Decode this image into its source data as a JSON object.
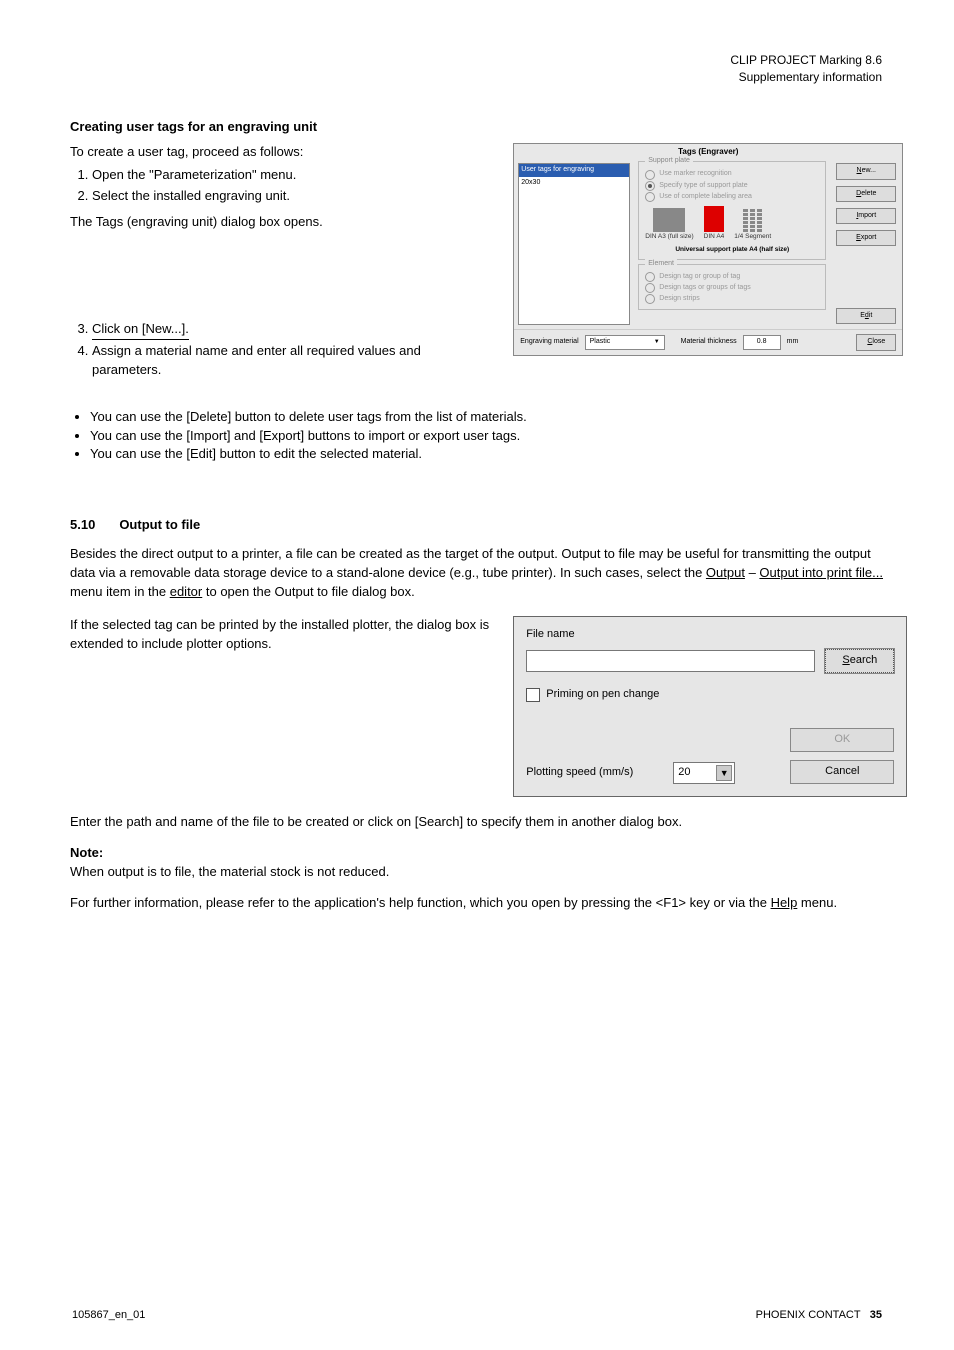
{
  "header": {
    "product": "CLIP PROJECT Marking 8.6",
    "subtitle": "Supplementary information"
  },
  "tagsSection": {
    "title": "Creating user tags for an engraving unit",
    "intro": "To create a user tag, proceed as follows:",
    "steps": [
      "Open the \"Parameterization\" menu.",
      "Select the installed engraving unit."
    ],
    "after": "The Tags (engraving unit) dialog box opens.",
    "followup": [
      "Click on [New...].",
      "Assign a material name and enter all required values and parameters."
    ],
    "bullets": [
      "You can use the [Delete] button to delete user tags from the list of materials.",
      "You can use the [Import] and [Export] buttons to import or export user tags.",
      "You can use the [Edit] button to edit the selected material."
    ]
  },
  "tagsDialog": {
    "title": "Tags (Engraver)",
    "list": {
      "header": "User tags for engraving",
      "item": "20x30"
    },
    "groupSupport": {
      "legend": "Support plate",
      "opt1": "Use marker recognition",
      "opt2": "Specify type of support plate",
      "opt3": "Use of complete labeling area",
      "plateA3": "DIN A3 (full size)",
      "plateA4": "DIN A4",
      "plateSeg": "1/4 Segment",
      "caption": "Universal support plate A4 (half size)"
    },
    "groupElement": {
      "legend": "Element",
      "opt1": "Design tag or group of tag",
      "opt2": "Design tags or groups of tags",
      "opt3": "Design strips"
    },
    "buttons": {
      "new": {
        "mn": "N",
        "rest": "ew..."
      },
      "del": {
        "mn": "D",
        "rest": "elete"
      },
      "imp": {
        "mn": "I",
        "rest": "mport"
      },
      "exp": {
        "mn": "E",
        "rest": "xport"
      },
      "edit": {
        "pre": "E",
        "mn": "d",
        "rest": "it"
      },
      "close": {
        "mn": "C",
        "rest": "lose"
      }
    },
    "footer": {
      "matLabel": "Engraving material",
      "matValue": "Plastic",
      "thickLabel": "Material thickness",
      "thickValue": "0.8",
      "unit": "mm"
    }
  },
  "fileSection": {
    "h1": {
      "num": "5.10",
      "text": "Output to file"
    },
    "p1a": "Besides the direct output to a printer, a file can be created as the target of the output. Output to file may be useful for transmitting the output data via a removable data storage device to a stand-alone device (e.g., tube printer). In such cases, select the ",
    "p1_link1": "Output",
    "p1b": " – ",
    "p1_link2": "Output into print file...",
    "p1c": " menu item in the ",
    "p1_link3": "editor",
    "p1d": " to open the Output to file dialog box.",
    "p2": "If the selected tag can be printed by the installed plotter, the dialog box is extended to include plotter options."
  },
  "outDialog": {
    "fileLabel": "File name",
    "searchBtn": {
      "mn": "S",
      "rest": "earch"
    },
    "priming": "Priming on pen change",
    "speedLabel": "Plotting speed (mm/s)",
    "speedValue": "20",
    "okBtn": {
      "mn": "O",
      "rest": "K"
    },
    "cancelBtn": {
      "mn": "C",
      "rest": "ancel"
    }
  },
  "endText": {
    "t1": "Enter the path and name of the file to be created or click on [Search] to specify them in another dialog box.",
    "noteTitle": "Note:",
    "noteBody": "When output is to file, the material stock is not reduced.",
    "t2a": "For further information, please refer to the application's help function, which you open by pressing the ",
    "t2key": "<F1>",
    "t2b": " key or via the ",
    "t2link": "Help",
    "t2c": " menu."
  },
  "footer": {
    "code": "105867_en_01",
    "company": "PHOENIX CONTACT",
    "page": "35"
  }
}
